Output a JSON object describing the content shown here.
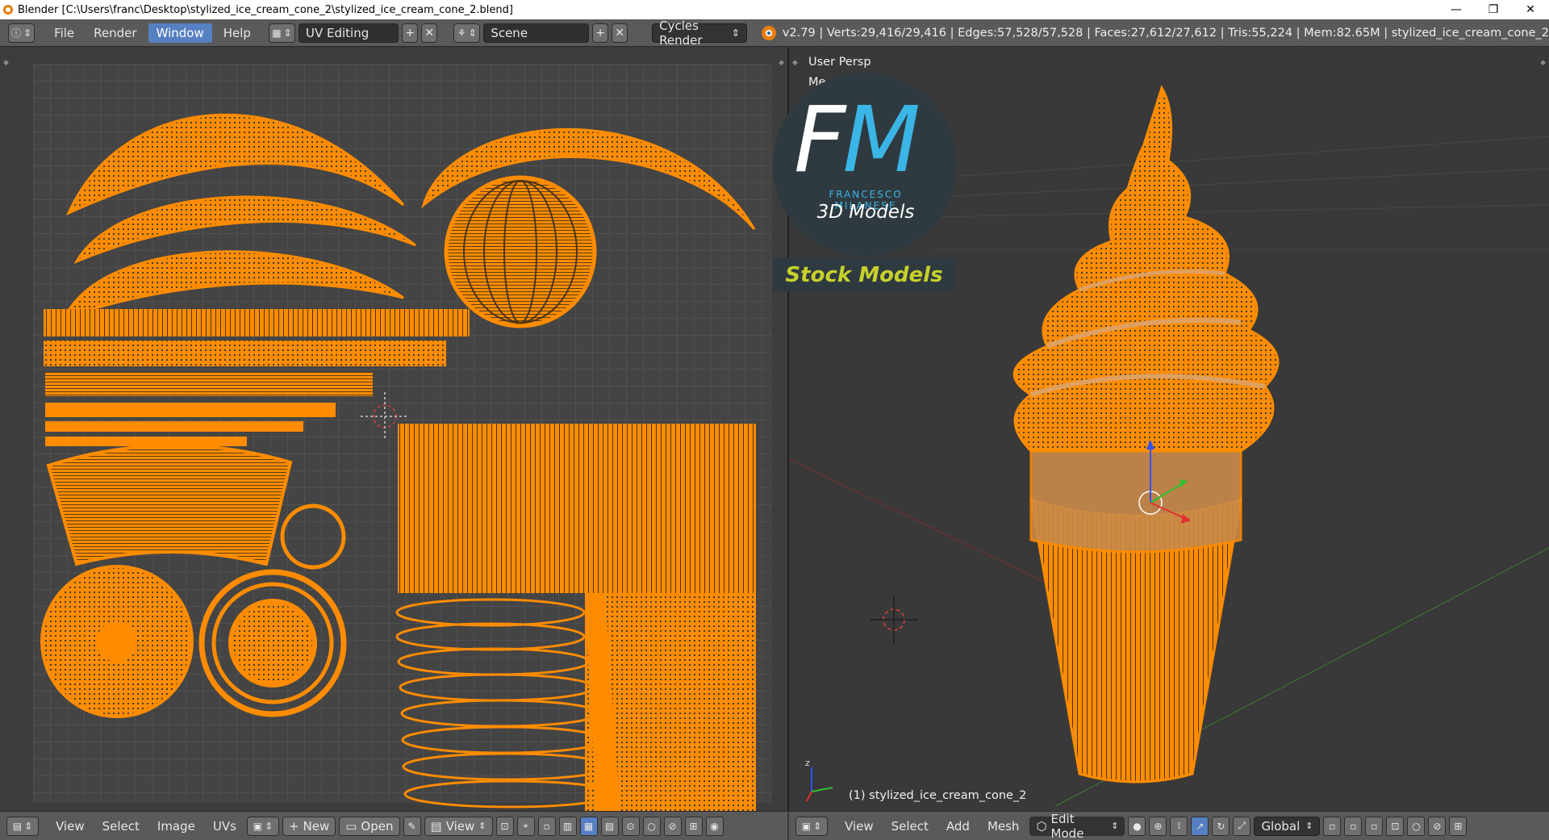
{
  "window": {
    "title": "Blender [C:\\Users\\franc\\Desktop\\stylized_ice_cream_cone_2\\stylized_ice_cream_cone_2.blend]",
    "minimize": "—",
    "maximize": "❐",
    "close": "✕"
  },
  "info_header": {
    "menus": [
      "File",
      "Render",
      "Window",
      "Help"
    ],
    "active_menu": "Window",
    "screen_layout": "UV Editing",
    "scene": "Scene",
    "render_engine": "Cycles Render",
    "stats": "v2.79 | Verts:29,416/29,416 | Edges:57,528/57,528 | Faces:27,612/27,612 | Tris:55,224 | Mem:82.65M | stylized_ice_cream_cone_2"
  },
  "uv_editor": {
    "header": {
      "menus": [
        "View",
        "Select",
        "Image",
        "UVs"
      ],
      "new_label": "New",
      "open_label": "Open",
      "view_label": "View"
    }
  },
  "viewport": {
    "view_name": "User Persp",
    "mode_overlay": "Me",
    "object_label": "(1) stylized_ice_cream_cone_2",
    "header": {
      "menus": [
        "View",
        "Select",
        "Add",
        "Mesh"
      ],
      "mode": "Edit Mode",
      "orientation": "Global"
    }
  },
  "watermark": {
    "letters_f": "F",
    "letters_m": "M",
    "author": "FRANCESCO MILANESE",
    "subtitle": "3D Models",
    "stock": "Stock Models"
  },
  "colors": {
    "uv_mesh": "#ff8c00",
    "header_bg": "#5a5a5a",
    "active_button": "#5680c2",
    "brand_blue": "#3ab5e6",
    "stock_yellow": "#c7d12a"
  }
}
